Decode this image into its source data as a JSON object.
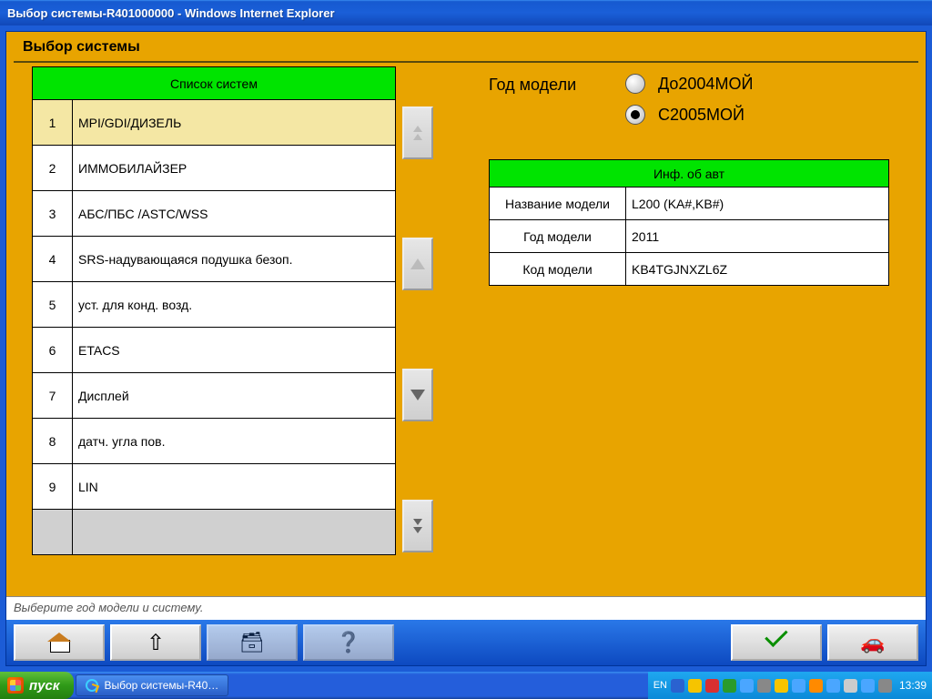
{
  "window": {
    "title": "Выбор системы-R401000000 - Windows Internet Explorer"
  },
  "page": {
    "heading": "Выбор системы"
  },
  "systems": {
    "header": "Список систем",
    "items": [
      {
        "n": "1",
        "label": "MPI/GDI/ДИЗЕЛЬ"
      },
      {
        "n": "2",
        "label": "ИММОБИЛАЙЗЕР"
      },
      {
        "n": "3",
        "label": "АБС/ПБС /ASTC/WSS"
      },
      {
        "n": "4",
        "label": "SRS-надувающаяся подушка безоп."
      },
      {
        "n": "5",
        "label": "уст. для конд. возд."
      },
      {
        "n": "6",
        "label": "ETACS"
      },
      {
        "n": "7",
        "label": "Дисплей"
      },
      {
        "n": "8",
        "label": "датч. угла пов."
      },
      {
        "n": "9",
        "label": "LIN"
      }
    ]
  },
  "year": {
    "label": "Год модели",
    "options": [
      {
        "label": "До2004МОЙ"
      },
      {
        "label": "С2005МОЙ"
      }
    ]
  },
  "vehicle": {
    "header": "Инф. об авт",
    "rows": [
      {
        "k": "Название модели",
        "v": "L200 (KA#,KB#)"
      },
      {
        "k": "Год модели",
        "v": "2011"
      },
      {
        "k": "Код модели",
        "v": "KB4TGJNXZL6Z"
      }
    ]
  },
  "status": {
    "text": "Выберите год модели и систему."
  },
  "taskbar": {
    "start": "пуск",
    "task": "Выбор системы-R40…",
    "lang": "EN",
    "clock": "13:39"
  }
}
